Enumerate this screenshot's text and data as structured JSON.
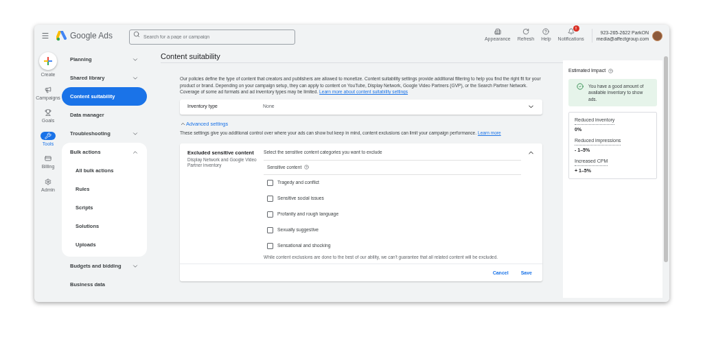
{
  "header": {
    "app_name": "Google Ads",
    "search": {
      "placeholder": "Search for a page or campaign"
    },
    "actions": [
      {
        "kind": "appearance",
        "label": "Appearance"
      },
      {
        "kind": "refresh",
        "label": "Refresh"
      },
      {
        "kind": "help",
        "label": "Help"
      },
      {
        "kind": "notifications",
        "label": "Notifications",
        "badge": "!"
      }
    ],
    "account": {
      "name": "923-265-2622 ParkON",
      "email": "media@affectgroup.com"
    }
  },
  "rail": {
    "create_label": "Create",
    "items": [
      {
        "kind": "campaigns",
        "label": "Campaigns",
        "selected": false
      },
      {
        "kind": "goals",
        "label": "Goals",
        "selected": false
      },
      {
        "kind": "tools",
        "label": "Tools",
        "selected": true
      },
      {
        "kind": "billing",
        "label": "Billing",
        "selected": false
      },
      {
        "kind": "admin",
        "label": "Admin",
        "selected": false
      }
    ]
  },
  "nav": [
    {
      "kind": "group",
      "label": "Planning",
      "expanded": false,
      "selected": false
    },
    {
      "kind": "group",
      "label": "Shared library",
      "expanded": false,
      "selected": false
    },
    {
      "kind": "link",
      "label": "Content suitability",
      "selected": true
    },
    {
      "kind": "link",
      "label": "Data manager",
      "selected": false
    },
    {
      "kind": "group",
      "label": "Troubleshooting",
      "expanded": false,
      "selected": false
    },
    {
      "kind": "group",
      "label": "Bulk actions",
      "expanded": true,
      "selected": false,
      "children": [
        {
          "label": "All bulk actions",
          "selected": false
        },
        {
          "label": "Rules",
          "selected": false
        },
        {
          "label": "Scripts",
          "selected": false
        },
        {
          "label": "Solutions",
          "selected": false
        },
        {
          "label": "Uploads",
          "selected": false
        }
      ]
    },
    {
      "kind": "group",
      "label": "Budgets and bidding",
      "expanded": false,
      "selected": false
    },
    {
      "kind": "link",
      "label": "Business data",
      "selected": false
    }
  ],
  "main": {
    "title": "Content suitability",
    "description": "Our policies define the type of content that creators and publishers are allowed to monetize. Content suitability settings provide additional filtering to help you find the right fit for your product or brand. Depending on your campaign setup, they can apply to content on YouTube, Display Network, Google Video Partners (GVP), or the Search Partner Network. Coverage of some ad formats and ad inventory types may be limited.",
    "description_link": "Learn more about content suitability settings",
    "inventory_type": {
      "label": "Inventory type",
      "value": "None",
      "expanded": false
    },
    "advanced": {
      "label": "Advanced settings",
      "expanded": true,
      "note": "These settings give you additional control over where your ads can show but keep in mind, content exclusions can limit your campaign performance.",
      "note_link": "Learn more"
    },
    "excluded": {
      "title": "Excluded sensitive content",
      "subtitle": "Display Network and Google Video Partner inventory",
      "prompt": "Select the sensitive content categories you want to exclude",
      "expanded": true,
      "column_header": "Sensitive content",
      "options": [
        {
          "label": "Tragedy and conflict",
          "checked": false
        },
        {
          "label": "Sensitive social issues",
          "checked": false
        },
        {
          "label": "Profanity and rough language",
          "checked": false
        },
        {
          "label": "Sexually suggestive",
          "checked": false
        },
        {
          "label": "Sensational and shocking",
          "checked": false
        }
      ],
      "disclaimer": "While content exclusions are done to the best of our ability, we can't guarantee that all related content will be excluded.",
      "buttons": [
        "Cancel",
        "Save"
      ]
    }
  },
  "impact": {
    "title": "Estimated Impact",
    "message": "You have a good amount of available inventory to show ads.",
    "metrics": [
      {
        "label": "Reduced inventory",
        "value": "0%"
      },
      {
        "label": "Reduced impressions",
        "value": "- 1–5%"
      },
      {
        "label": "Increased CPM",
        "value": "+ 1–5%"
      }
    ]
  }
}
